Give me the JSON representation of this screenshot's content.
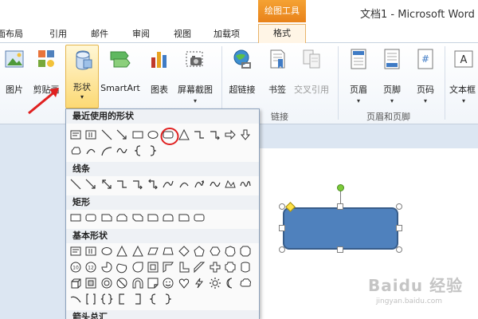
{
  "titlebar": {
    "drawing_tools": "绘图工具",
    "doc_title": "文档1 - Microsoft Word"
  },
  "tabs": [
    "面布局",
    "引用",
    "邮件",
    "审阅",
    "视图",
    "加载项",
    "格式"
  ],
  "ribbon": {
    "buttons": [
      "图片",
      "剪贴画",
      "形状",
      "SmartArt",
      "图表",
      "屏幕截图",
      "超链接",
      "书签",
      "交叉引用",
      "页眉",
      "页脚",
      "页码",
      "文本框"
    ],
    "groups": [
      "链接",
      "页眉和页脚"
    ]
  },
  "gallery": {
    "sections": [
      "最近使用的形状",
      "线条",
      "矩形",
      "基本形状",
      "箭头总汇"
    ]
  },
  "watermark": {
    "text": "Baidu 经验",
    "sub": "jingyan.baidu.com"
  },
  "colors": {
    "accent_orange": "#f0a030",
    "shape_fill": "#4f81bd",
    "annotation_red": "#e02020"
  }
}
